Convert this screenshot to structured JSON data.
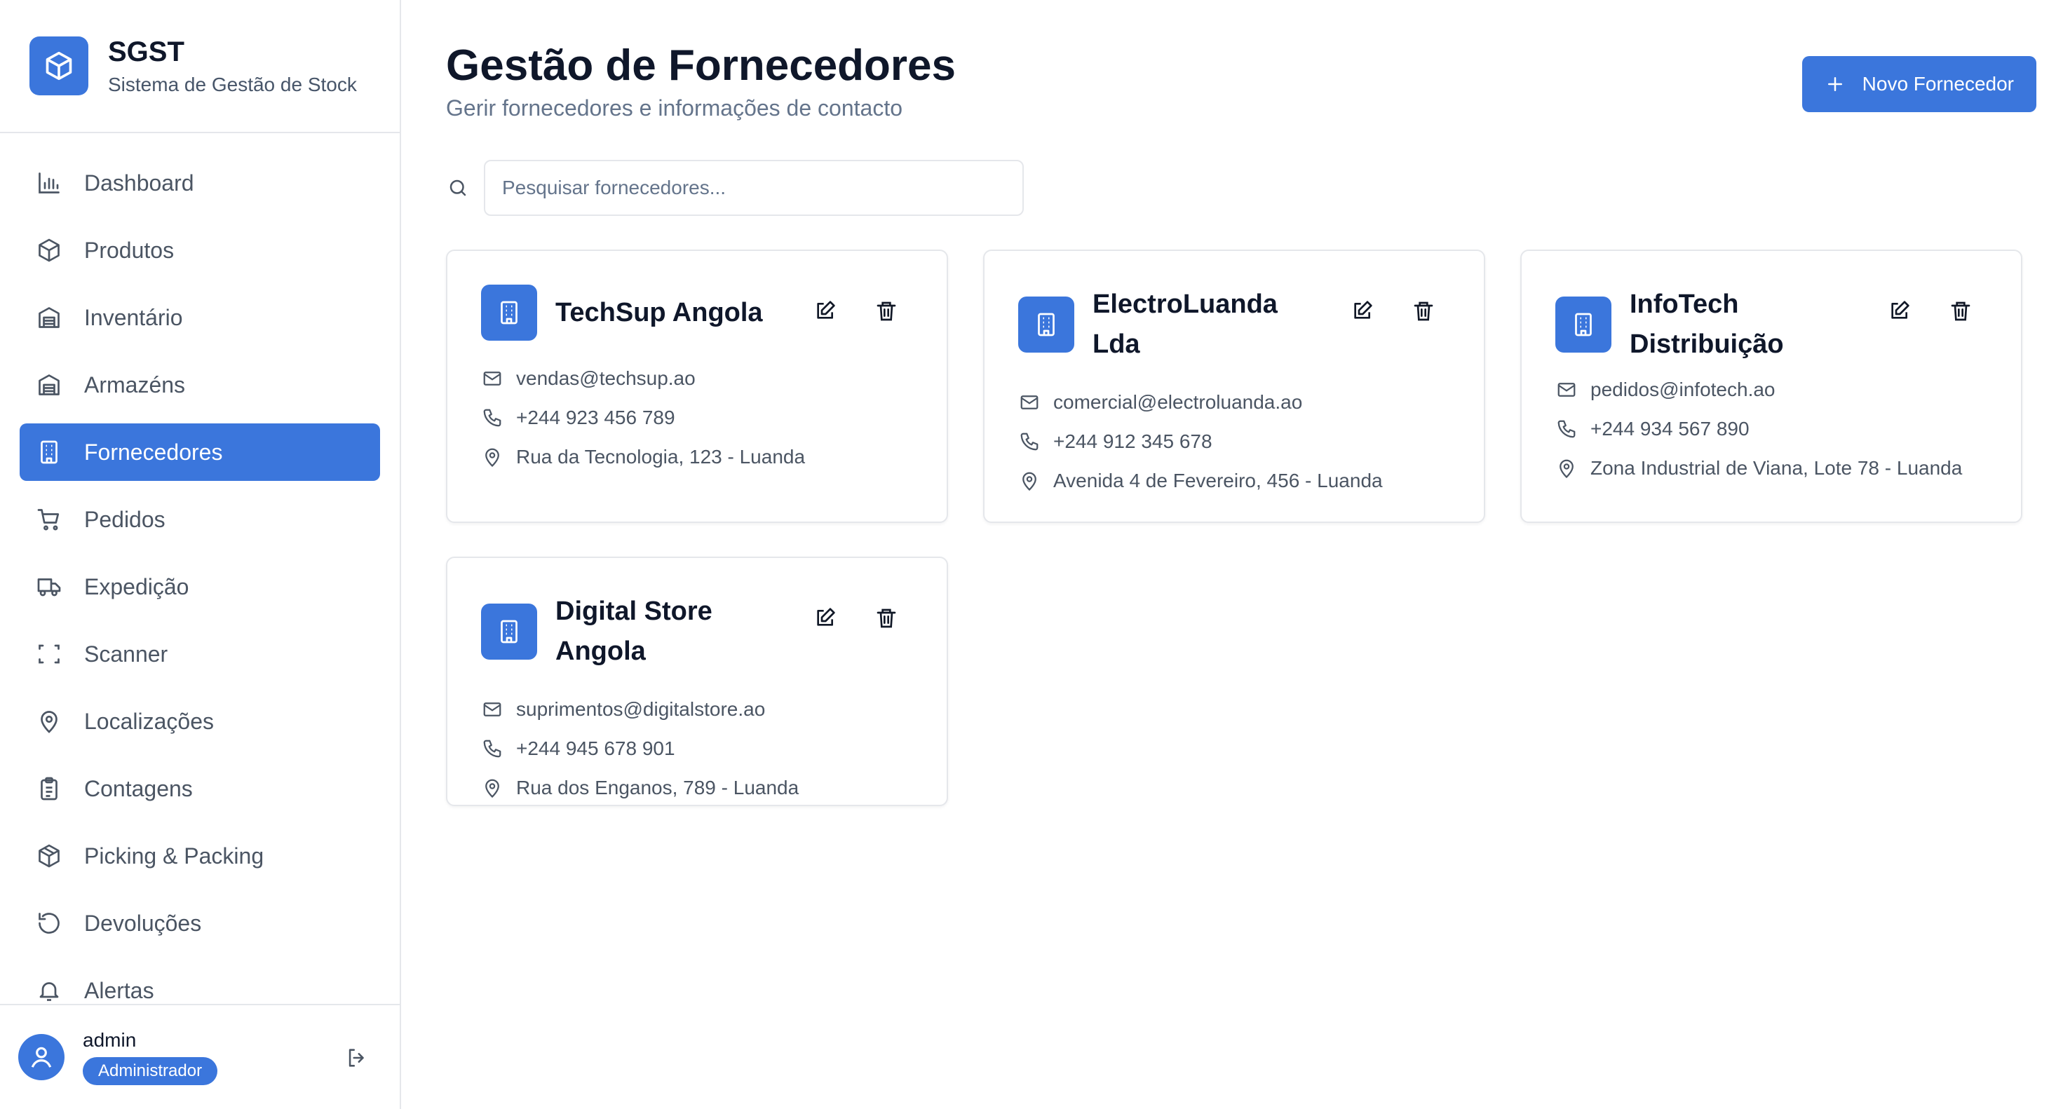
{
  "brand": {
    "title": "SGST",
    "subtitle": "Sistema de Gestão de Stock"
  },
  "sidebar": {
    "items": [
      {
        "label": "Dashboard",
        "icon": "bar-chart-icon",
        "active": false
      },
      {
        "label": "Produtos",
        "icon": "box-icon",
        "active": false
      },
      {
        "label": "Inventário",
        "icon": "warehouse-icon",
        "active": false
      },
      {
        "label": "Armazéns",
        "icon": "warehouse-icon",
        "active": false
      },
      {
        "label": "Fornecedores",
        "icon": "building-icon",
        "active": true
      },
      {
        "label": "Pedidos",
        "icon": "cart-icon",
        "active": false
      },
      {
        "label": "Expedição",
        "icon": "truck-icon",
        "active": false
      },
      {
        "label": "Scanner",
        "icon": "scan-icon",
        "active": false
      },
      {
        "label": "Localizações",
        "icon": "map-pin-icon",
        "active": false
      },
      {
        "label": "Contagens",
        "icon": "clipboard-icon",
        "active": false
      },
      {
        "label": "Picking & Packing",
        "icon": "package-icon",
        "active": false
      },
      {
        "label": "Devoluções",
        "icon": "undo-icon",
        "active": false
      },
      {
        "label": "Alertas",
        "icon": "bell-icon",
        "active": false
      }
    ]
  },
  "user": {
    "name": "admin",
    "role": "Administrador"
  },
  "header": {
    "title": "Gestão de Fornecedores",
    "subtitle": "Gerir fornecedores e informações de contacto",
    "new_button": "Novo Fornecedor"
  },
  "search": {
    "placeholder": "Pesquisar fornecedores...",
    "value": ""
  },
  "suppliers": [
    {
      "name": "TechSup Angola",
      "email": "vendas@techsup.ao",
      "phone": "+244 923 456 789",
      "address": "Rua da Tecnologia, 123 - Luanda"
    },
    {
      "name": "ElectroLuanda Lda",
      "email": "comercial@electroluanda.ao",
      "phone": "+244 912 345 678",
      "address": "Avenida 4 de Fevereiro, 456 - Luanda"
    },
    {
      "name": "InfoTech Distribuição",
      "email": "pedidos@infotech.ao",
      "phone": "+244 934 567 890",
      "address": "Zona Industrial de Viana, Lote 78 - Luanda"
    },
    {
      "name": "Digital Store Angola",
      "email": "suprimentos@digitalstore.ao",
      "phone": "+244 945 678 901",
      "address": "Rua dos Enganos, 789 - Luanda"
    }
  ],
  "colors": {
    "accent": "#3b76dc",
    "text": "#0f172a",
    "muted": "#4b5563",
    "border": "#e5e7eb"
  }
}
